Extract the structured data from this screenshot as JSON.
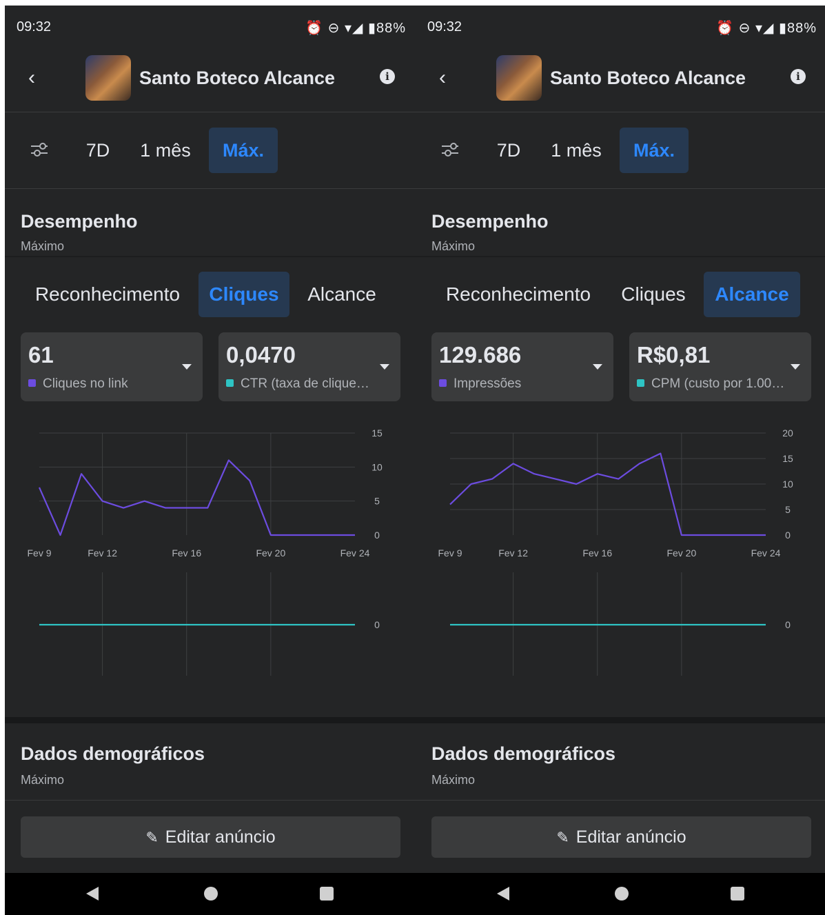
{
  "screens": [
    {
      "status": {
        "time": "09:32",
        "icons": "⏰ ⊖ ▾◢ ▮88%"
      },
      "header": {
        "title": "Santo Boteco Alcance"
      },
      "filters": [
        "7D",
        "1 mês",
        "Máx."
      ],
      "active_filter": "Máx.",
      "performance": {
        "title": "Desempenho",
        "subtitle": "Máximo"
      },
      "tabs": [
        "Reconhecimento",
        "Cliques",
        "Alcance"
      ],
      "active_tab": "Cliques",
      "metrics": [
        {
          "value": "61",
          "label": "Cliques no link",
          "color": "#6c4ce0"
        },
        {
          "value": "0,0470",
          "label": "CTR (taxa de clique…",
          "color": "#2ec4c4"
        }
      ],
      "demographics": {
        "title": "Dados demográficos",
        "subtitle": "Máximo"
      },
      "edit_button": "Editar anúncio"
    },
    {
      "status": {
        "time": "09:32",
        "icons": "⏰ ⊖ ▾◢ ▮88%"
      },
      "header": {
        "title": "Santo Boteco Alcance"
      },
      "filters": [
        "7D",
        "1 mês",
        "Máx."
      ],
      "active_filter": "Máx.",
      "performance": {
        "title": "Desempenho",
        "subtitle": "Máximo"
      },
      "tabs": [
        "Reconhecimento",
        "Cliques",
        "Alcance"
      ],
      "active_tab": "Alcance",
      "metrics": [
        {
          "value": "129.686",
          "label": "Impressões",
          "color": "#6c4ce0"
        },
        {
          "value": "R$0,81",
          "label": "CPM (custo por 1.00…",
          "color": "#2ec4c4"
        }
      ],
      "demographics": {
        "title": "Dados demográficos",
        "subtitle": "Máximo"
      },
      "edit_button": "Editar anúncio"
    }
  ],
  "chart_data": [
    {
      "type": "line",
      "x": [
        "Fev 9",
        "Fev 10",
        "Fev 11",
        "Fev 12",
        "Fev 13",
        "Fev 14",
        "Fev 15",
        "Fev 16",
        "Fev 17",
        "Fev 18",
        "Fev 19",
        "Fev 20",
        "Fev 21",
        "Fev 22",
        "Fev 23",
        "Fev 24"
      ],
      "xticks": [
        "Fev 9",
        "Fev 12",
        "Fev 16",
        "Fev 20",
        "Fev 24"
      ],
      "series": [
        {
          "values": [
            7,
            0,
            9,
            5,
            4,
            5,
            4,
            4,
            4,
            11,
            8,
            0,
            0,
            0,
            0,
            0
          ],
          "color": "#6c4ce0"
        }
      ],
      "yticks": [
        0,
        5,
        10,
        15
      ],
      "ylim": [
        0,
        15
      ],
      "grid": true
    },
    {
      "type": "line",
      "x": [
        "Fev 9",
        "Fev 10",
        "Fev 11",
        "Fev 12",
        "Fev 13",
        "Fev 14",
        "Fev 15",
        "Fev 16",
        "Fev 17",
        "Fev 18",
        "Fev 19",
        "Fev 20",
        "Fev 21",
        "Fev 22",
        "Fev 23",
        "Fev 24"
      ],
      "xticks": [
        "Fev 9",
        "Fev 12",
        "Fev 16",
        "Fev 20",
        "Fev 24"
      ],
      "series": [
        {
          "values": [
            6,
            10,
            11,
            14,
            12,
            11,
            10,
            12,
            11,
            14,
            16,
            0,
            0,
            0,
            0,
            0
          ],
          "color": "#6c4ce0"
        }
      ],
      "yticks": [
        0,
        5,
        10,
        15,
        20
      ],
      "ylim": [
        0,
        20
      ],
      "grid": true
    }
  ],
  "secondary_chart": {
    "ytick": "0",
    "value": 0,
    "color": "#2ec4c4"
  }
}
